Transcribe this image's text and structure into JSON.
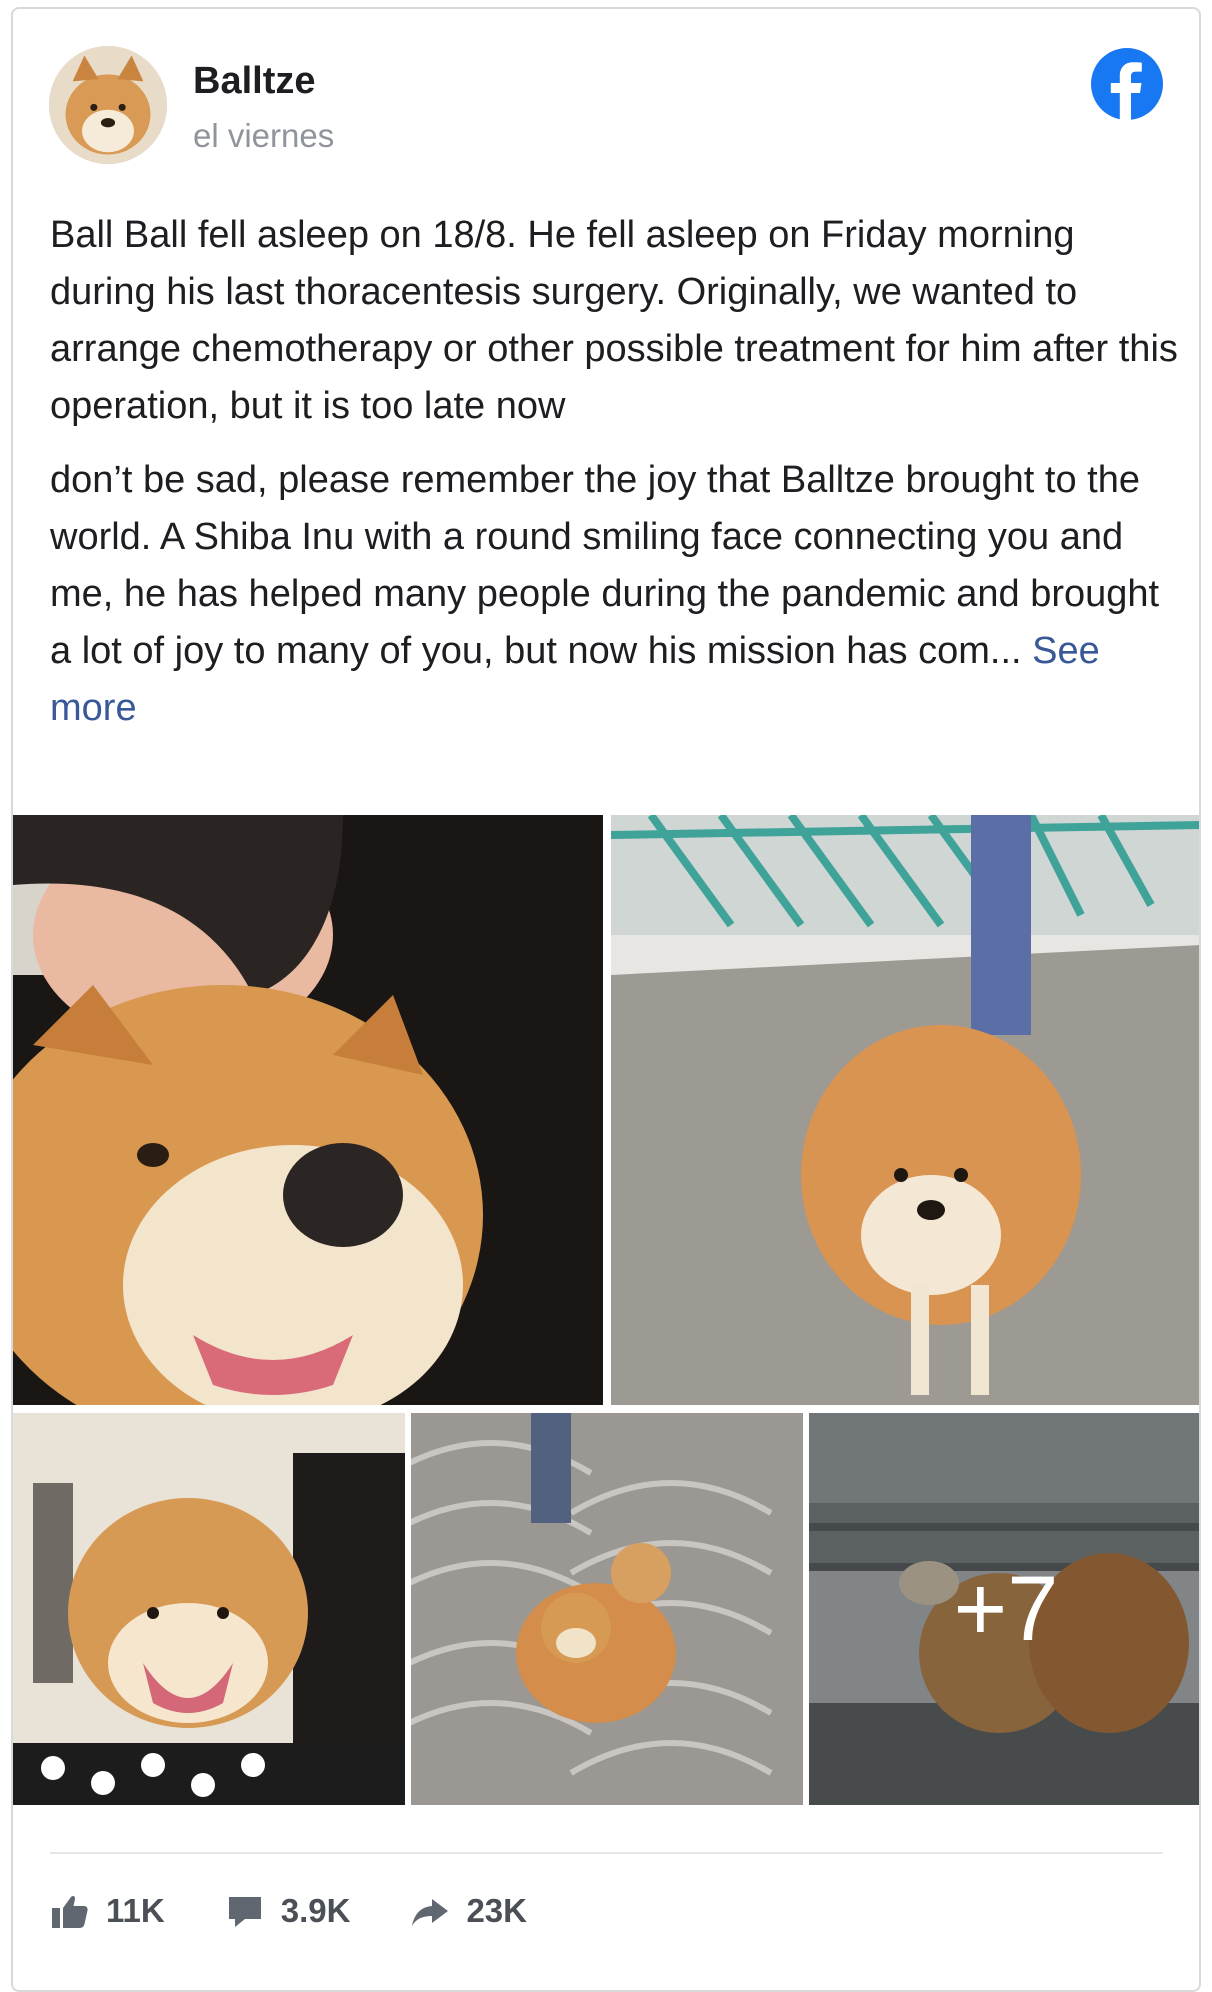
{
  "post": {
    "author": "Balltze",
    "timestamp": "el viernes",
    "paragraph_1": "Ball Ball fell asleep on 18/8. He fell asleep on Friday morning during his last thoracentesis surgery. Originally, we wanted to arrange chemotherapy or other possible treatment for him after this operation, but it is too late now",
    "paragraph_2": "don’t be sad, please remember the joy that Balltze brought to the world. A Shiba Inu with a round smiling face connecting you and me, he has helped many people during the pandemic and brought a lot of joy to many of you, but now his mission has com...",
    "see_more": "See more"
  },
  "photos": {
    "more_count": "+7"
  },
  "stats": {
    "likes": "11K",
    "comments": "3.9K",
    "shares": "23K"
  },
  "colors": {
    "facebook_blue": "#1877f2",
    "link_blue": "#385898",
    "muted_gray": "#90949c"
  },
  "icons": {
    "brand": "facebook-logo-icon",
    "like": "thumbs-up-icon",
    "comment": "comment-bubble-icon",
    "share": "share-arrow-icon"
  }
}
